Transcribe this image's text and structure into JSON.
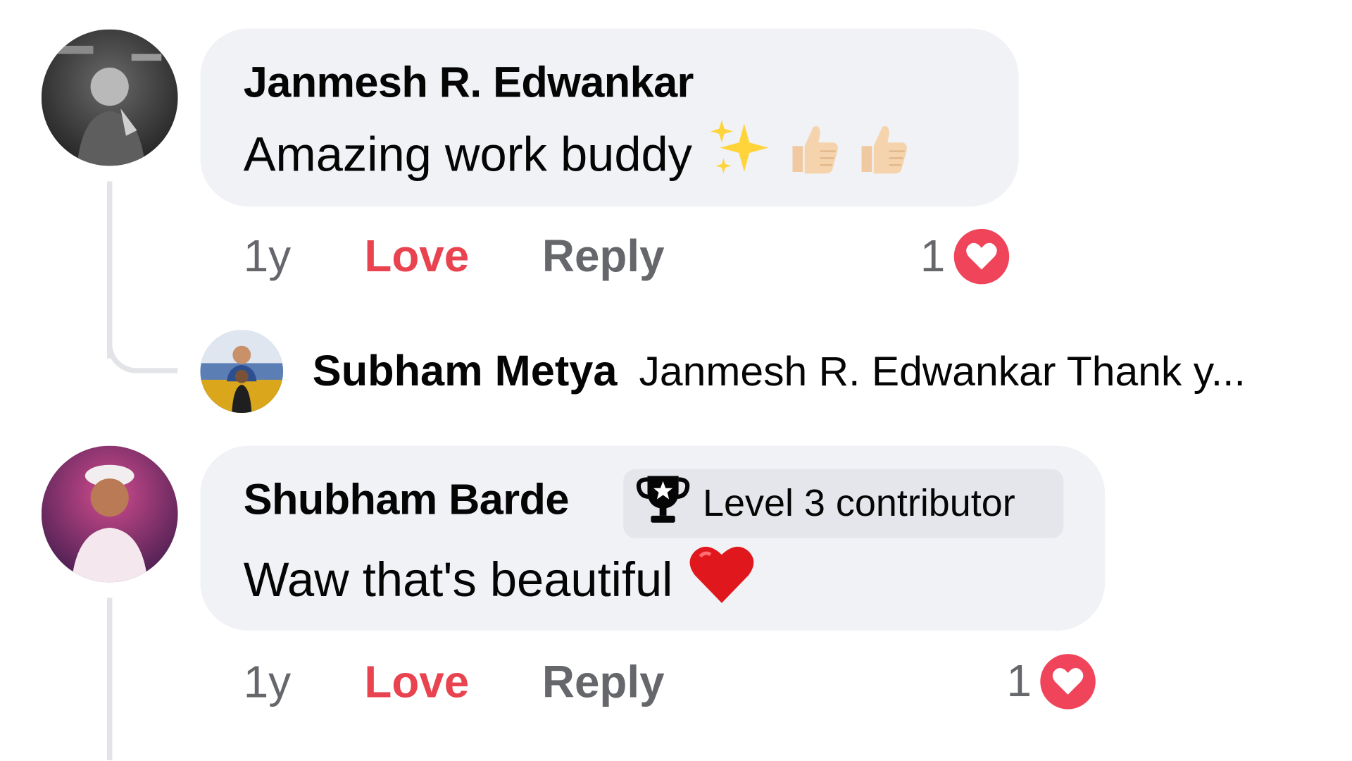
{
  "comments": [
    {
      "author": "Janmesh R. Edwankar",
      "text": "Amazing work buddy",
      "emojis": [
        "sparkles-emoji",
        "thumbs-up-emoji",
        "thumbs-up-emoji"
      ],
      "time": "1y",
      "love_label": "Love",
      "reply_label": "Reply",
      "reaction_count": "1",
      "reaction_icon": "heart-icon"
    },
    {
      "author": "Shubham Barde",
      "badge_icon": "trophy-icon",
      "badge_label": "Level 3 contributor",
      "text": "Waw that's beautiful",
      "emojis": [
        "red-heart-emoji"
      ],
      "time": "1y",
      "love_label": "Love",
      "reply_label": "Reply",
      "reaction_count": "1",
      "reaction_icon": "heart-icon"
    }
  ],
  "reply_preview": {
    "author": "Subham Metya",
    "text": "Janmesh R. Edwankar Thank y..."
  },
  "colors": {
    "bubble": "#f0f2f5",
    "love": "#e8434f",
    "meta": "#65676b",
    "heart_badge": "#f0445a"
  }
}
